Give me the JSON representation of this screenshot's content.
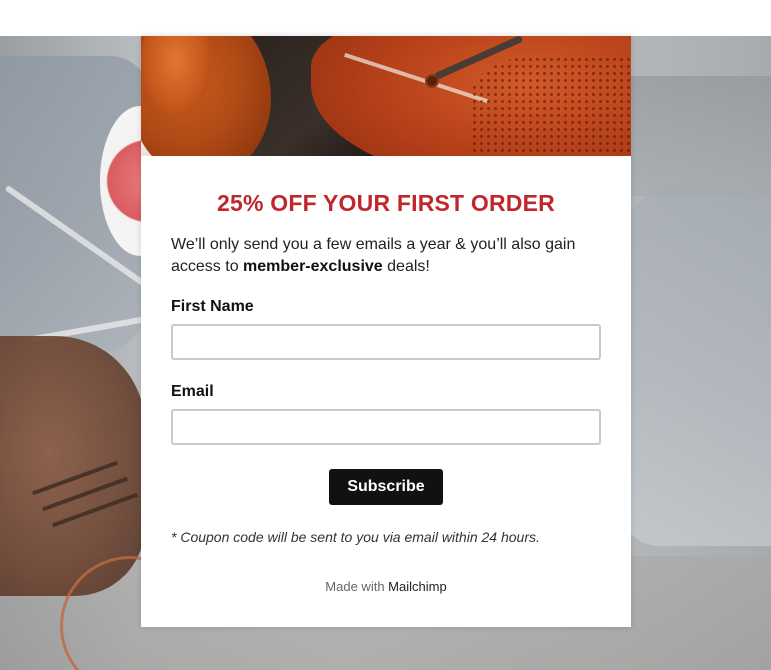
{
  "popup": {
    "heading": "25% OFF YOUR FIRST ORDER",
    "intro_text": "We’ll only send you a few emails a year & you’ll also gain access to",
    "intro_bold": "member-exclusive",
    "intro_end": "deals!",
    "first_name_label": "First Name",
    "first_name_value": "",
    "email_label": "Email",
    "email_value": "",
    "subscribe_label": "Subscribe",
    "coupon_note": "* Coupon code will be sent to you via email within 24 hours.",
    "made_with_prefix": "Made with",
    "made_with_brand": "Mailchimp"
  },
  "colors": {
    "heading": "#c0272d",
    "button_bg": "#111111",
    "button_text": "#ffffff",
    "page_bg": "#ffffff"
  }
}
